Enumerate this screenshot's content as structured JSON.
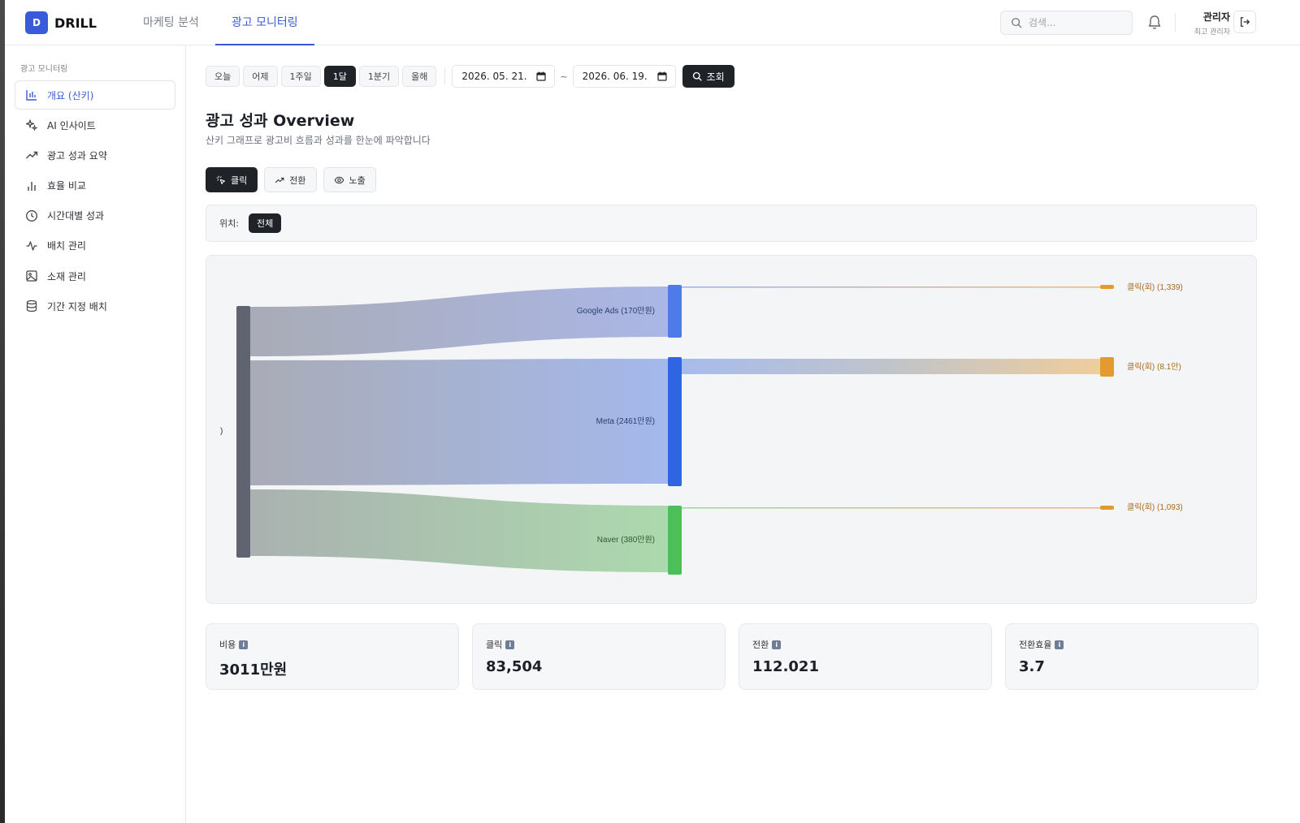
{
  "app": {
    "logo_letter": "D",
    "name": "DRILL"
  },
  "topnav": {
    "tabs": [
      {
        "label": "마케팅 분석"
      },
      {
        "label": "광고 모니터링"
      }
    ]
  },
  "search": {
    "placeholder": "검색..."
  },
  "user": {
    "name": "관리자",
    "role": "최고 관리자"
  },
  "sidebar": {
    "section_title": "광고 모니터링",
    "items": [
      {
        "label": "개요 (산키)",
        "icon": "bar-chart-icon",
        "active": true
      },
      {
        "label": "AI 인사이트",
        "icon": "sparkles-icon"
      },
      {
        "label": "광고 성과 요약",
        "icon": "trending-up-icon"
      },
      {
        "label": "효율 비교",
        "icon": "bar-compare-icon"
      },
      {
        "label": "시간대별 성과",
        "icon": "clock-icon"
      },
      {
        "label": "배치 관리",
        "icon": "activity-icon"
      },
      {
        "label": "소재 관리",
        "icon": "image-icon"
      },
      {
        "label": "기간 지정 배치",
        "icon": "database-icon"
      }
    ]
  },
  "filters": {
    "ranges": [
      {
        "label": "오늘"
      },
      {
        "label": "어제"
      },
      {
        "label": "1주일"
      },
      {
        "label": "1달",
        "active": true
      },
      {
        "label": "1분기"
      },
      {
        "label": "올해"
      }
    ],
    "start_date": "2026. 05. 21.",
    "end_date": "2026. 06. 19.",
    "tilde": "~",
    "query_label": "조회"
  },
  "page": {
    "title": "광고 성과 Overview",
    "subtitle": "산키 그래프로 광고비 흐름과 성과를 한눈에 파악합니다"
  },
  "metric_tabs": [
    {
      "label": "클릭",
      "icon": "click-icon",
      "active": true
    },
    {
      "label": "전환",
      "icon": "trending-up-icon"
    },
    {
      "label": "노출",
      "icon": "eye-icon"
    }
  ],
  "position": {
    "label": "위치:",
    "selected": "전체"
  },
  "chart_data": {
    "type": "sankey",
    "source_label": ")",
    "nodes": [
      {
        "name": "Google Ads (170만원)",
        "color": "#4f7be8"
      },
      {
        "name": "Meta (2461만원)",
        "color": "#2f64e3"
      },
      {
        "name": "Naver (380만원)",
        "color": "#4cbe5a"
      },
      {
        "name": "클릭(회) (1,339)",
        "color": "#e59a2f"
      },
      {
        "name": "클릭(회) (8.1만)",
        "color": "#e59a2f"
      },
      {
        "name": "클릭(회) (1,093)",
        "color": "#e59a2f"
      }
    ],
    "source_color": "#5f6470"
  },
  "stats": [
    {
      "label": "비용",
      "value": "3011만원"
    },
    {
      "label": "클릭",
      "value": "83,504"
    },
    {
      "label": "전환",
      "value": "112.021"
    },
    {
      "label": "전환효율",
      "value": "3.7"
    }
  ],
  "colors": {
    "accent": "#3a5bd9",
    "dark": "#1f2328"
  }
}
